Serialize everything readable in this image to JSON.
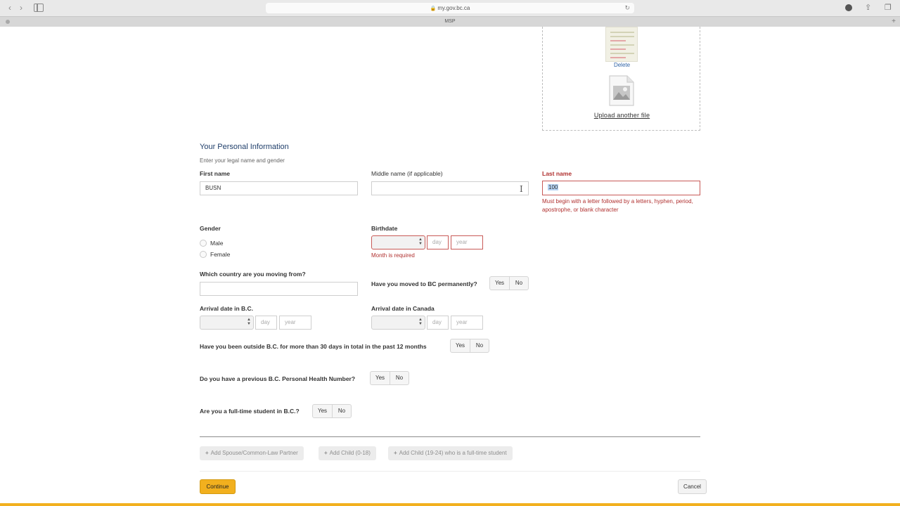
{
  "browser": {
    "url": "my.gov.bc.ca",
    "tab_title": "MSP"
  },
  "upload": {
    "delete_label": "Delete",
    "upload_another_label": "Upload another file"
  },
  "personal": {
    "title": "Your Personal Information",
    "subtitle": "Enter your legal name and gender",
    "first_name_label": "First name",
    "first_name_value": "BUSN",
    "middle_name_label": "Middle name (if applicable)",
    "middle_name_value": "",
    "last_name_label": "Last name",
    "last_name_value": "100",
    "last_name_error": "Must begin with a letter followed by a letters, hyphen, period, apostrophe, or blank character",
    "gender_label": "Gender",
    "gender_options": [
      "Male",
      "Female"
    ],
    "birthdate_label": "Birthdate",
    "birthdate_day_placeholder": "day",
    "birthdate_year_placeholder": "year",
    "birthdate_error": "Month is required",
    "country_label": "Which country are you moving from?",
    "country_value": "",
    "moved_permanently_label": "Have you moved to BC permanently?",
    "arrival_bc_label": "Arrival date in B.C.",
    "arrival_canada_label": "Arrival date in Canada",
    "day_placeholder": "day",
    "year_placeholder": "year",
    "outside_bc_label": "Have you been outside B.C. for more than 30 days in total in the past 12 months",
    "phn_label": "Do you have a previous B.C. Personal Health Number?",
    "student_label": "Are you a full-time student in B.C.?",
    "yes": "Yes",
    "no": "No"
  },
  "add_buttons": {
    "spouse": "Add Spouse/Common-Law Partner",
    "child_0_18": "Add Child (0-18)",
    "child_19_24": "Add Child (19-24) who is a full-time student"
  },
  "footer": {
    "continue": "Continue",
    "cancel": "Cancel"
  },
  "colors": {
    "accent": "#f2b01e",
    "error": "#b0302f",
    "title": "#1f3e6a",
    "link": "#2f63a6"
  }
}
